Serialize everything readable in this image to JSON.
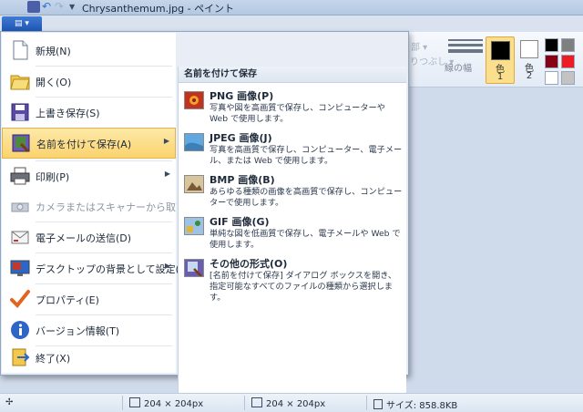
{
  "window": {
    "title": "Chrysanthemum.jpg - ペイント"
  },
  "app_button": {
    "label": "▤ ▾"
  },
  "ribbon": {
    "ghost_1": "部 ▾",
    "ghost_2": "りつぶし ▾",
    "line_width_label": "線の幅",
    "color1": {
      "l1": "色",
      "l2": "1"
    },
    "color2": {
      "l1": "色",
      "l2": "2"
    },
    "palette": [
      "#000000",
      "#7f7f7f",
      "#880015",
      "#ed1c24",
      "#ffffff",
      "#c3c3c3",
      "#b97a57",
      "#ffaec9"
    ]
  },
  "app_menu": {
    "items": [
      {
        "label": "新規(N)"
      },
      {
        "label": "開く(O)"
      },
      {
        "label": "上書き保存(S)"
      },
      {
        "label": "名前を付けて保存(A)"
      },
      {
        "label": "印刷(P)"
      },
      {
        "label": "カメラまたはスキャナーから取り込み(M)"
      },
      {
        "label": "電子メールの送信(D)"
      },
      {
        "label": "デスクトップの背景として設定(B)"
      },
      {
        "label": "プロパティ(E)"
      },
      {
        "label": "バージョン情報(T)"
      },
      {
        "label": "終了(X)"
      }
    ],
    "submenu": {
      "header": "名前を付けて保存",
      "items": [
        {
          "title": "PNG 画像(P)",
          "desc": "写真や図を高画質で保存し、コンピューターや Web で使用します。"
        },
        {
          "title": "JPEG 画像(J)",
          "desc": "写真を高画質で保存し、コンピューター、電子メール、または Web で使用します。"
        },
        {
          "title": "BMP 画像(B)",
          "desc": "あらゆる種類の画像を高画質で保存し、コンピューターで使用します。"
        },
        {
          "title": "GIF 画像(G)",
          "desc": "単純な図を低画質で保存し、電子メールや Web で使用します。"
        },
        {
          "title": "その他の形式(O)",
          "desc": "[名前を付けて保存] ダイアログ ボックスを開き、指定可能なすべてのファイルの種類から選択します。"
        }
      ]
    }
  },
  "status": {
    "cursor": "",
    "selection_size": "204 × 204px",
    "image_size": "204 × 204px",
    "file_size": "サイズ: 858.8KB"
  },
  "colors": {
    "accent": "#fbd36e",
    "ribbon": "#e3ebf6",
    "workspace": "#cfdaea"
  }
}
